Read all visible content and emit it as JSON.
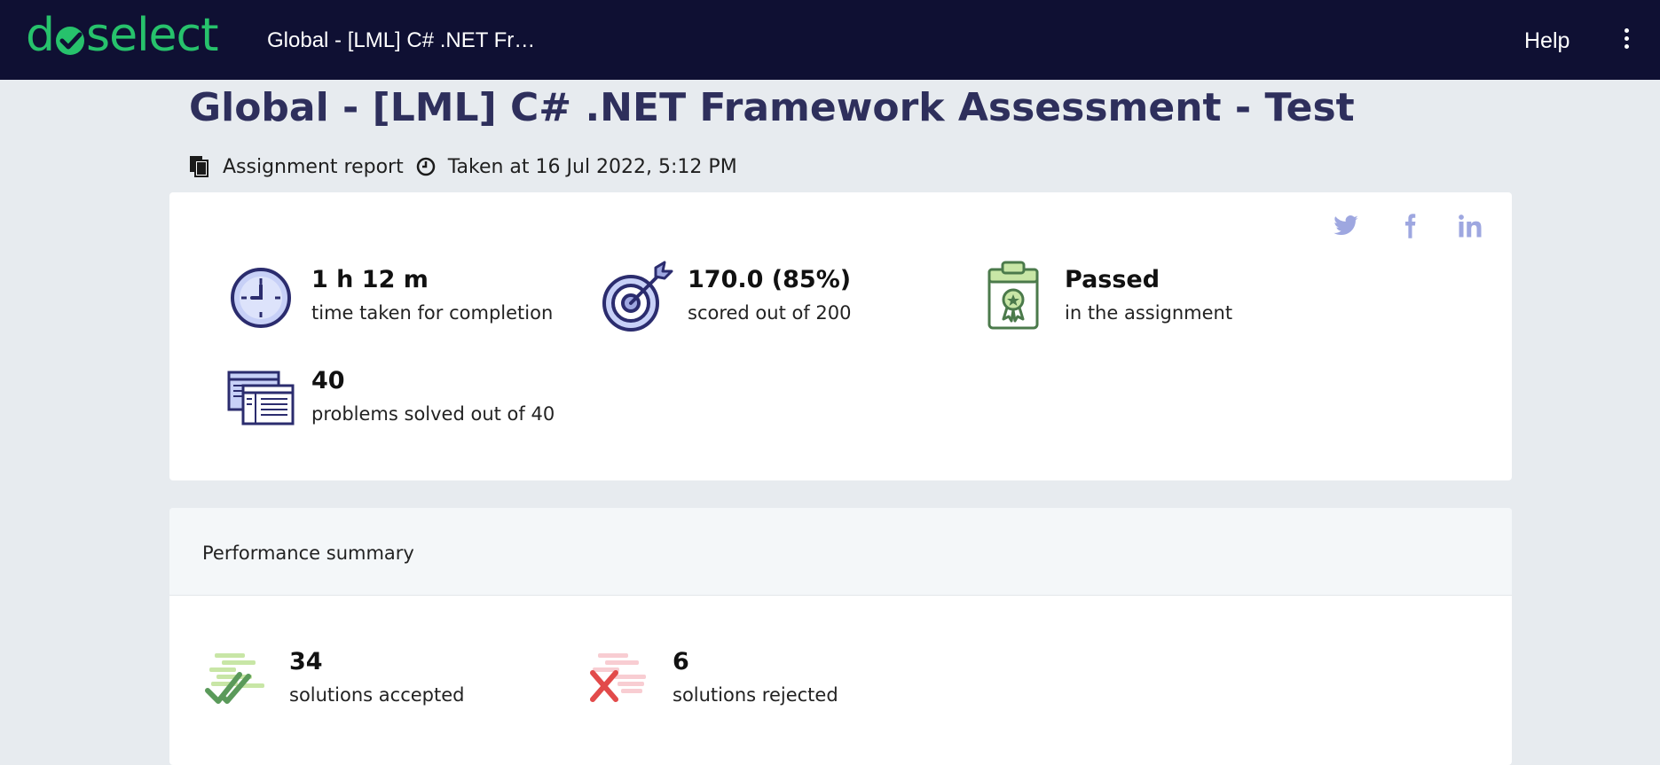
{
  "header": {
    "logo_left": "d",
    "logo_right": "select",
    "title": "Global - [LML] C# .NET Fr…",
    "help_label": "Help"
  },
  "page": {
    "title": "Global - [LML] C# .NET Framework Assessment - Test",
    "report_label": "Assignment report",
    "taken_at": "Taken at 16 Jul 2022, 5:12 PM"
  },
  "social": [
    "twitter-icon",
    "facebook-icon",
    "linkedin-icon"
  ],
  "stats": {
    "time": {
      "value": "1 h 12 m",
      "label": "time taken for completion"
    },
    "score": {
      "value": "170.0 (85%)",
      "label": "scored out of 200"
    },
    "result": {
      "value": "Passed",
      "label": "in the assignment"
    },
    "problems": {
      "value": "40",
      "label": "problems solved out of 40"
    }
  },
  "performance": {
    "title": "Performance summary",
    "accepted": {
      "value": "34",
      "label": "solutions accepted"
    },
    "rejected": {
      "value": "6",
      "label": "solutions rejected"
    }
  },
  "colors": {
    "topbar": "#0f1033",
    "brand_green": "#27c26c",
    "title_navy": "#2e2f5c",
    "social": "#9ea7e0",
    "accepted_green": "#5a9a5a",
    "rejected_red": "#e24a4a"
  }
}
